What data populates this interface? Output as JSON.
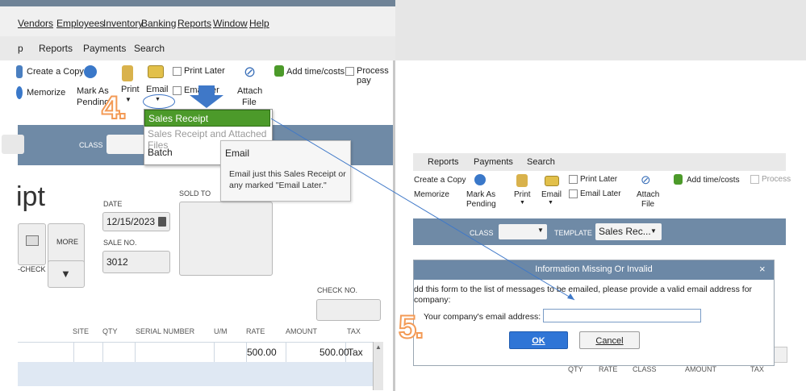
{
  "left": {
    "menu": [
      "Vendors",
      "Employees",
      "Inventory",
      "Banking",
      "Reports",
      "Window",
      "Help"
    ],
    "tabs": [
      "p",
      "Reports",
      "Payments",
      "Search"
    ],
    "ribbon": {
      "create_copy": "Create a Copy",
      "memorize": "Memorize",
      "mark_as": "Mark As",
      "pending": "Pending",
      "print": "Print",
      "email": "Email",
      "print_later": "Print Later",
      "email_later_partial": "Ema",
      "email_later_tail": "er",
      "attach": "Attach",
      "file": "File",
      "add_time_costs": "Add time/costs",
      "process_pay": "Process pay"
    },
    "strip": {
      "class_label": "CLASS"
    },
    "form": {
      "title_partial": "ipt",
      "date_label": "DATE",
      "date_value": "12/15/2023",
      "sold_to_label": "SOLD TO",
      "sale_no_label": "SALE NO.",
      "sale_no_value": "3012",
      "more_label": "MORE",
      "check_label": "-CHECK",
      "check_no_label": "CHECK NO."
    },
    "columns": [
      "SITE",
      "QTY",
      "SERIAL NUMBER",
      "U/M",
      "RATE",
      "AMOUNT",
      "TAX"
    ],
    "row": {
      "rate": "500.00",
      "amount": "500.00",
      "tax": "Tax"
    },
    "dropdown": {
      "sales_receipt": "Sales Receipt",
      "attached_files": "Sales Receipt and Attached Files",
      "batch": "Batch"
    },
    "tooltip": {
      "title": "Email",
      "body": "Email just this Sales Receipt or any marked \"Email Later.\""
    }
  },
  "right": {
    "tabs": [
      "Reports",
      "Payments",
      "Search"
    ],
    "ribbon": {
      "create_copy": "Create a Copy",
      "memorize": "Memorize",
      "mark_as": "Mark As",
      "pending": "Pending",
      "print": "Print",
      "email": "Email",
      "print_later": "Print Later",
      "email_later": "Email Later",
      "attach": "Attach",
      "file": "File",
      "add_time_costs": "Add time/costs",
      "process_partial": "Process"
    },
    "strip": {
      "class_label": "CLASS",
      "template_label": "TEMPLATE",
      "template_value": "Sales Rec..."
    },
    "dialog": {
      "title": "Information Missing Or Invalid",
      "close": "×",
      "message_line1": "dd this form to the list of messages to be emailed, please provide a valid email address for",
      "message_line2": "company:",
      "email_label": "Your company's email address:",
      "email_value": "",
      "ok": "OK",
      "cancel": "Cancel"
    },
    "columns": [
      "QTY",
      "RATE",
      "CLASS",
      "AMOUNT",
      "TAX"
    ]
  },
  "steps": {
    "four": "4.",
    "five": "5."
  },
  "colors": {
    "accent_green": "#4c9a2a",
    "strip_blue": "#6f8aa6",
    "step_orange": "#f39a55",
    "ok_blue": "#2f75d6"
  }
}
